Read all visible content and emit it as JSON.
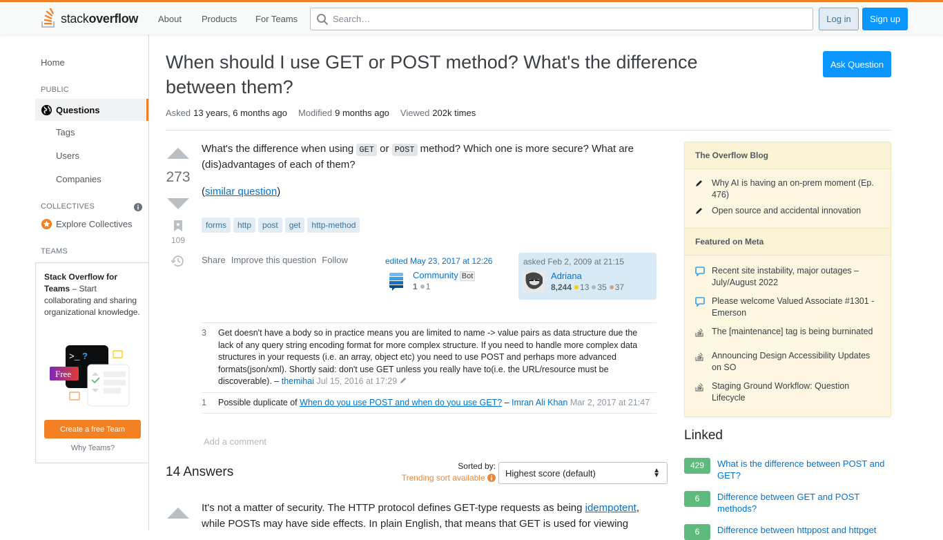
{
  "header": {
    "logo_light": "stack",
    "logo_bold": "overflow",
    "nav": [
      "About",
      "Products",
      "For Teams"
    ],
    "search_placeholder": "Search…",
    "login": "Log in",
    "signup": "Sign up",
    "accent": "#f48024"
  },
  "leftbar": {
    "home": "Home",
    "public_heading": "PUBLIC",
    "questions": "Questions",
    "tags": "Tags",
    "users": "Users",
    "companies": "Companies",
    "collectives_heading": "COLLECTIVES",
    "explore_collectives": "Explore Collectives",
    "teams_heading": "TEAMS",
    "teams_title": "Stack Overflow for Teams",
    "teams_text": " – Start collaborating and sharing organizational knowledge.",
    "teams_free": "Free",
    "teams_button": "Create a free Team",
    "teams_why": "Why Teams?"
  },
  "question": {
    "title": "When should I use GET or POST method? What's the difference between them?",
    "ask_button": "Ask Question",
    "asked_label": "Asked",
    "asked_value": "13 years, 6 months ago",
    "modified_label": "Modified",
    "modified_value": "9 months ago",
    "viewed_label": "Viewed",
    "viewed_value": "202k times",
    "score": "273",
    "bookmarks": "109",
    "body_1": "What's the difference when using ",
    "code_get": "GET",
    "body_2": " or ",
    "code_post": "POST",
    "body_3": " method? Which one is more secure? What are (dis)advantages of each of them?",
    "paren_open": "(",
    "similar_link": "similar question",
    "paren_close": ")",
    "tags": [
      "forms",
      "http",
      "post",
      "get",
      "http-method"
    ],
    "actions": [
      "Share",
      "Improve this question",
      "Follow"
    ],
    "edited": {
      "when": "edited May 23, 2017 at 12:26",
      "user": "Community",
      "badge": "Bot",
      "rep": "1",
      "silver": "1"
    },
    "asked": {
      "when": "asked Feb 2, 2009 at 21:15",
      "user": "Adriana",
      "rep": "8,244",
      "gold": "13",
      "silver": "35",
      "bronze": "37"
    }
  },
  "comments": [
    {
      "score": "3",
      "text": "Get doesn't have a body so in practice means you are limited to name -> value pairs as data structure due the lack of any query string encoding format for more complex structure. If you need to handle more complex data structures in your requests (i.e. an array, object etc) you need to use POST and perhaps more advanced formats(json/xml). Shortly said: don't use GET unless you really have to(i.e. the URL/resource must be discoverable). – ",
      "user": "themihai",
      "date": "Jul 15, 2016 at 17:29"
    },
    {
      "score": "1",
      "prefix": "Possible duplicate of ",
      "link": "When do you use POST and when do you use GET?",
      "dash": " – ",
      "user": "Imran Ali Khan",
      "date": "Mar 2, 2017 at 21:47"
    }
  ],
  "add_comment": "Add a comment",
  "answers": {
    "heading": "14 Answers",
    "sorted_by": "Sorted by:",
    "trending": "Trending sort available",
    "sort_selected": "Highest score (default)",
    "first_body_1": "It's not a matter of security. The HTTP protocol defines GET-type requests as being ",
    "first_link": "idempotent",
    "first_body_2": ", while POSTs may have side effects. In plain English, that means that GET is used for viewing"
  },
  "sidebar": {
    "blog_heading": "The Overflow Blog",
    "blog_items": [
      "Why AI is having an on-prem moment (Ep. 476)",
      "Open source and accidental innovation"
    ],
    "meta_heading": "Featured on Meta",
    "meta_items": [
      {
        "icon": "chat-bubble-icon",
        "text": "Recent site instability, major outages – July/August 2022"
      },
      {
        "icon": "chat-bubble-icon",
        "text": "Please welcome Valued Associate #1301 - Emerson"
      },
      {
        "icon": "stackoverflow-icon",
        "text": "The [maintenance] tag is being burninated"
      },
      {
        "icon": "stackoverflow-icon",
        "text": "Announcing Design Accessibility Updates on SO"
      },
      {
        "icon": "stackoverflow-icon",
        "text": "Staging Ground Workflow: Question Lifecycle"
      }
    ],
    "linked_heading": "Linked",
    "linked": [
      {
        "score": "429",
        "title": "What is the difference between POST and GET?"
      },
      {
        "score": "6",
        "title": "Difference between GET and POST methods?"
      },
      {
        "score": "6",
        "title": "Difference between httppost and httpget"
      }
    ]
  }
}
